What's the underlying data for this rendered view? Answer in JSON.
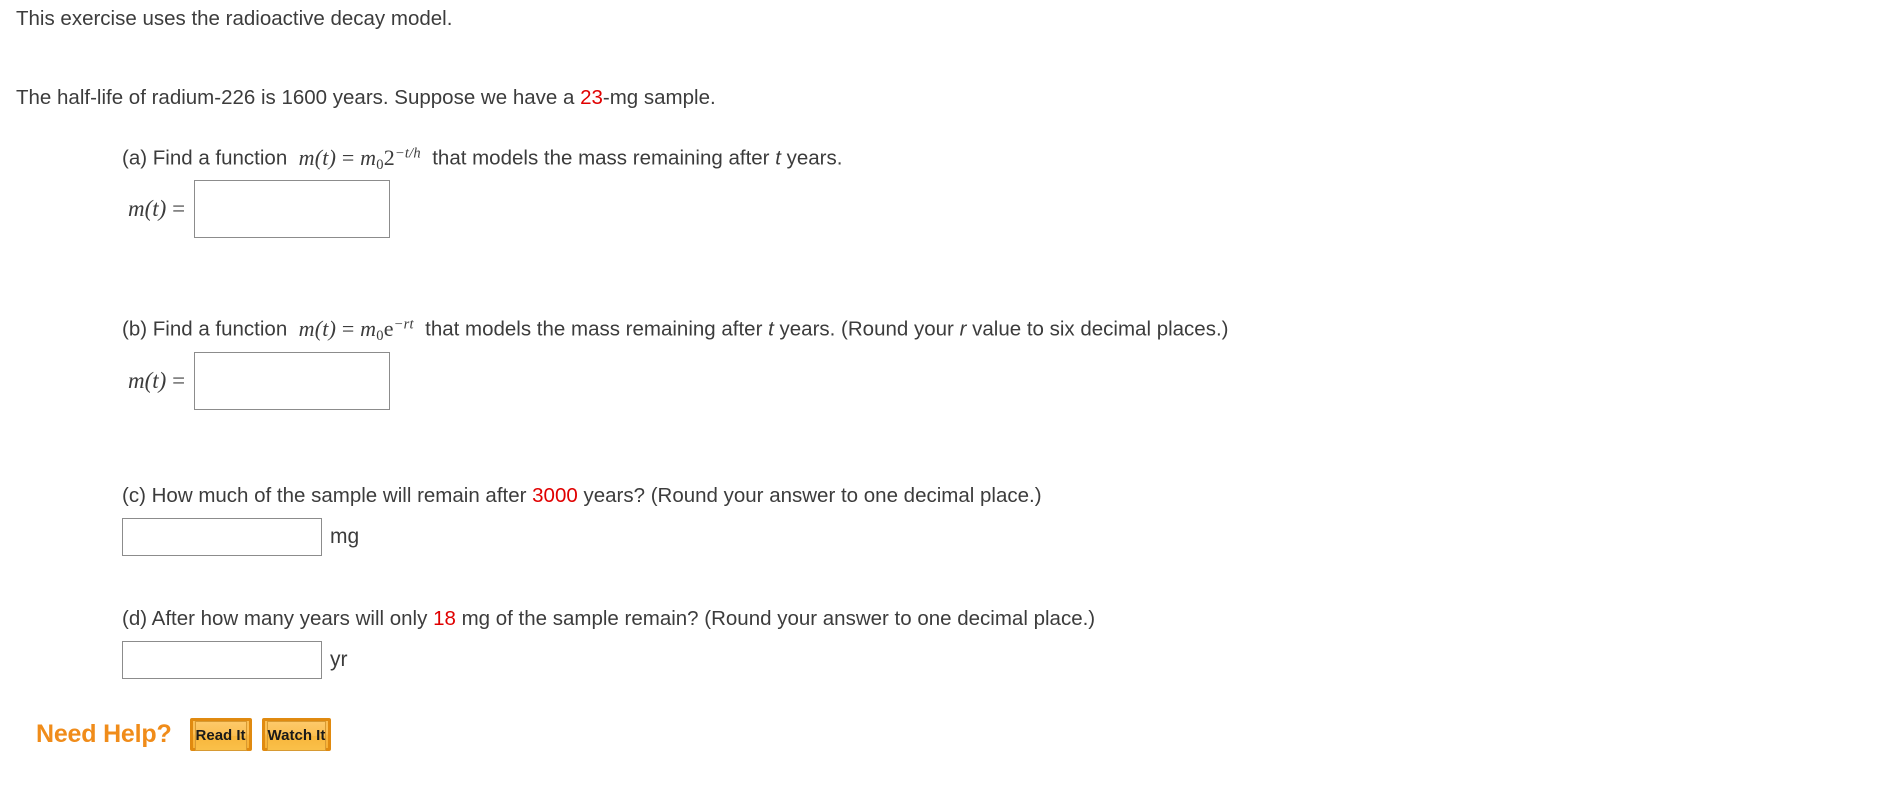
{
  "exercise": {
    "intro": "This exercise uses the radioactive decay model.",
    "stem": {
      "before": "The half-life of radium-226 is 1600 years. Suppose we have a ",
      "highlight": "23",
      "after": "-mg sample."
    },
    "parts": {
      "a": {
        "label": "(a)",
        "text_before": "Find a function",
        "formula_fn": "m(t)",
        "formula_eq": "=",
        "formula_base_var": "m",
        "formula_base_sub": "0",
        "formula_mantissa": "2",
        "formula_exponent": "−t/h",
        "text_after": "that models the mass remaining after",
        "text_var": "t",
        "text_tail": "years.",
        "answer_label_fn": "m(t)",
        "answer_label_eq": "=",
        "answer_value": "",
        "answer_placeholder": ""
      },
      "b": {
        "label": "(b)",
        "text_before": "Find a function",
        "formula_fn": "m(t)",
        "formula_eq": "=",
        "formula_base_var": "m",
        "formula_base_sub": "0",
        "formula_mantissa": "e",
        "formula_exponent": "−rt",
        "text_after": "that models the mass remaining after",
        "text_var": "t",
        "text_tail": "years. (Round your",
        "text_var2": "r",
        "text_tail2": "value to six decimal places.)",
        "answer_label_fn": "m(t)",
        "answer_label_eq": "=",
        "answer_value": "",
        "answer_placeholder": ""
      },
      "c": {
        "label": "(c)",
        "text_before": "How much of the sample will remain after",
        "highlight": "3000",
        "text_after": "years? (Round your answer to one decimal place.)",
        "answer_value": "",
        "answer_placeholder": "",
        "unit": "mg"
      },
      "d": {
        "label": "(d)",
        "text_before": "After how many years will only",
        "highlight": "18",
        "text_after": "mg of the sample remain? (Round your answer to one decimal place.)",
        "answer_value": "",
        "answer_placeholder": "",
        "unit": "yr"
      }
    }
  },
  "help": {
    "title": "Need Help?",
    "read_label": "Read It",
    "watch_label": "Watch It"
  },
  "colors": {
    "highlight": "#e00000",
    "text": "#3c3c3c",
    "help_title": "#f08c1a",
    "button_border": "#e08a10",
    "input_border": "#8c8c8c"
  }
}
